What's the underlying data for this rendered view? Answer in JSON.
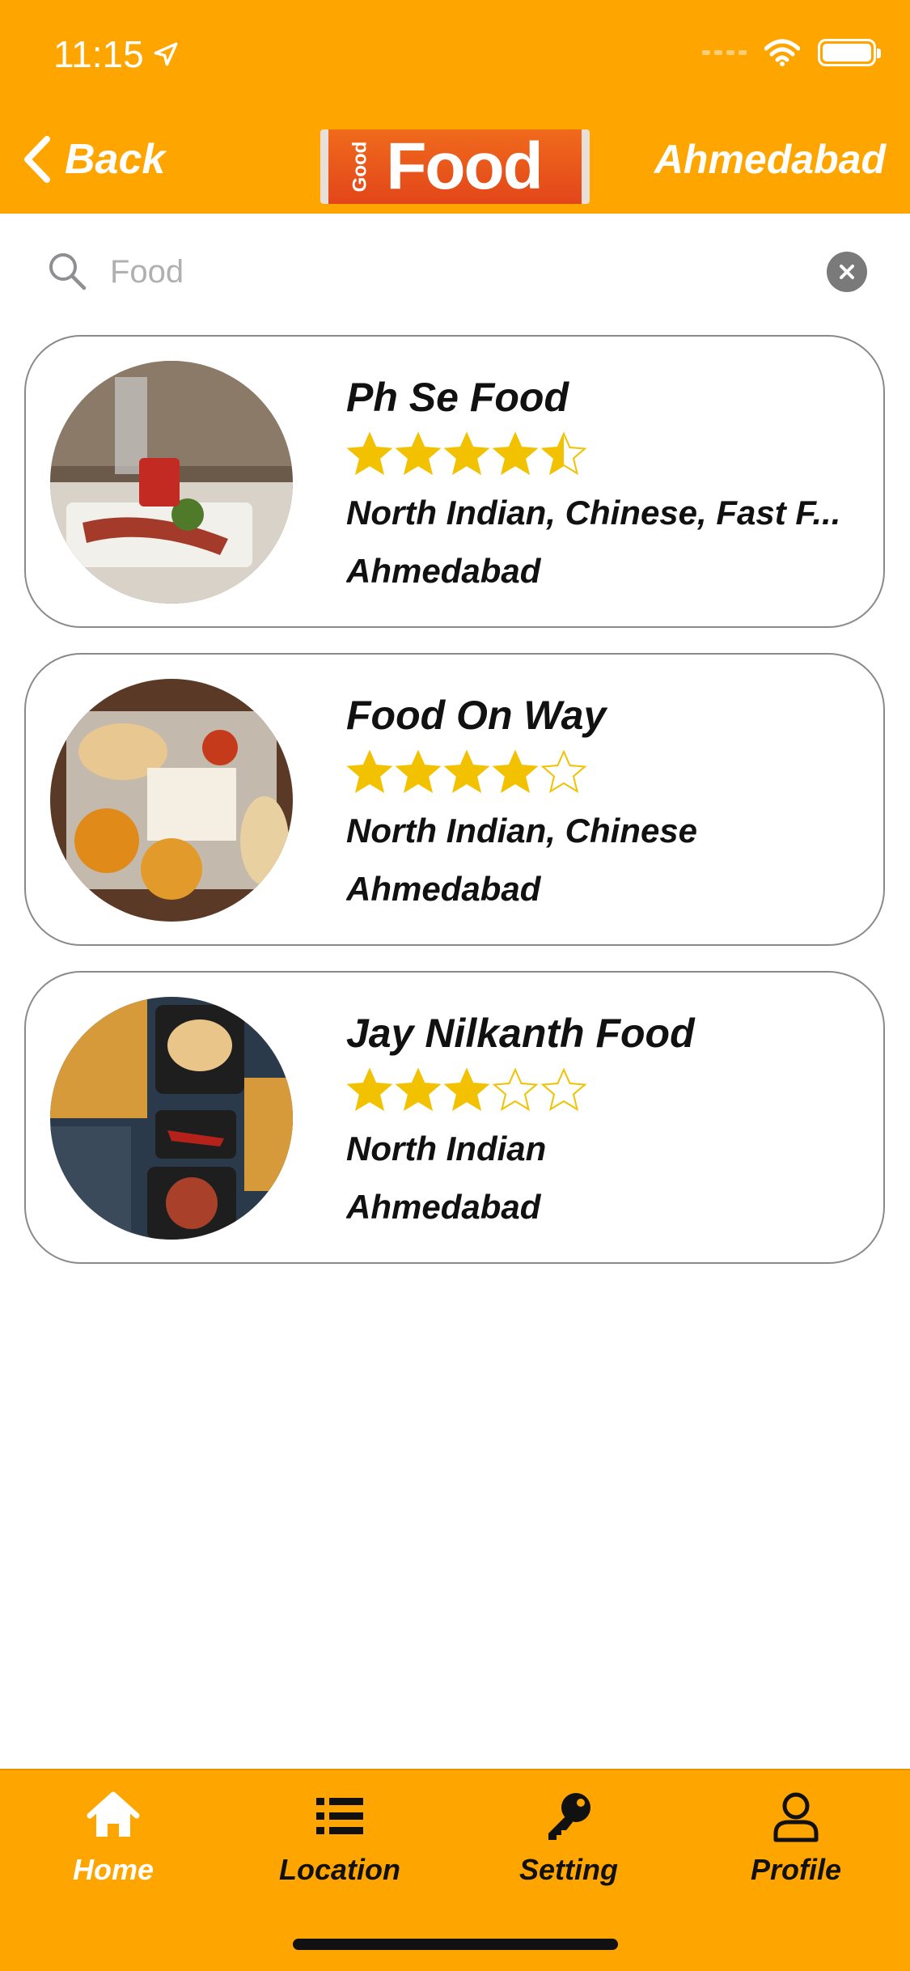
{
  "status_bar": {
    "time": "11:15"
  },
  "header": {
    "back_label": "Back",
    "logo_small": "Good",
    "logo_main": "Food",
    "city": "Ahmedabad"
  },
  "search": {
    "value": "",
    "placeholder": "Food"
  },
  "restaurants": [
    {
      "name": "Ph Se Food",
      "rating": 4.5,
      "cuisine": "North Indian, Chinese, Fast F...",
      "city": "Ahmedabad"
    },
    {
      "name": "Food On Way",
      "rating": 4,
      "cuisine": "North Indian, Chinese",
      "city": "Ahmedabad"
    },
    {
      "name": "Jay Nilkanth Food",
      "rating": 3,
      "cuisine": "North Indian",
      "city": "Ahmedabad"
    }
  ],
  "bottom_nav": {
    "active": "home",
    "items": [
      {
        "id": "home",
        "label": "Home",
        "icon": "home-icon"
      },
      {
        "id": "location",
        "label": "Location",
        "icon": "list-icon"
      },
      {
        "id": "setting",
        "label": "Setting",
        "icon": "key-icon"
      },
      {
        "id": "profile",
        "label": "Profile",
        "icon": "user-icon"
      }
    ]
  },
  "colors": {
    "accent": "#FFA500",
    "star": "#F2C200",
    "text": "#111111"
  }
}
